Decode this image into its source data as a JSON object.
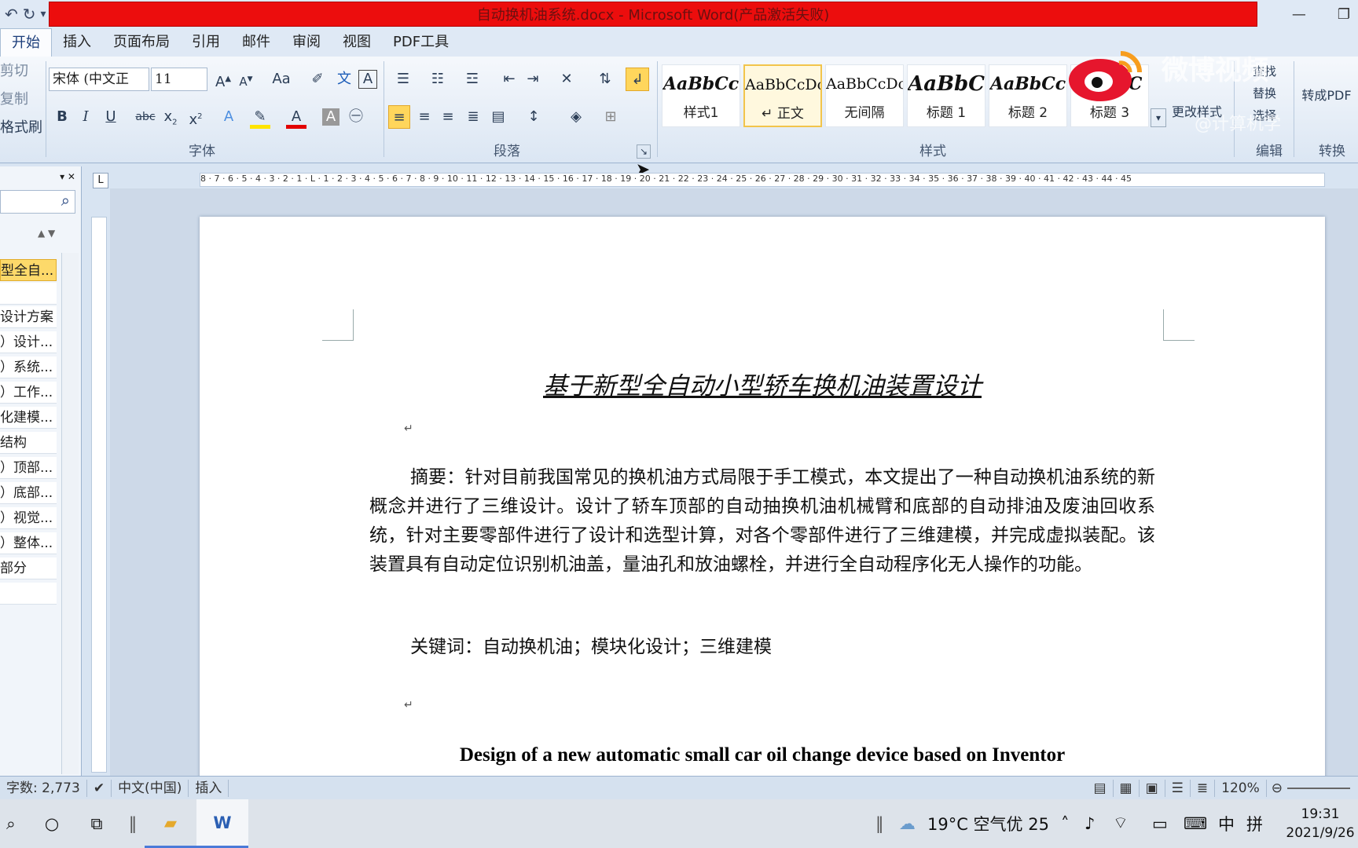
{
  "window": {
    "title": "自动换机油系统.docx - Microsoft Word(产品激活失败)"
  },
  "qat": {
    "undo": "↶",
    "redo": "↻",
    "more": "▾"
  },
  "tabs": [
    "开始",
    "插入",
    "页面布局",
    "引用",
    "邮件",
    "审阅",
    "视图",
    "PDF工具"
  ],
  "clipboard": {
    "cut": "剪切",
    "copy": "复制",
    "painter": "格式刷"
  },
  "font": {
    "name": "宋体 (中文正",
    "size": "11",
    "group": "字体"
  },
  "paragraph": {
    "group": "段落"
  },
  "styles": {
    "group": "样式",
    "items": [
      {
        "sample": "AaBbCc",
        "name": "样式1"
      },
      {
        "sample": "AaBbCcDc",
        "name": "↵ 正文"
      },
      {
        "sample": "AaBbCcDc",
        "name": "无间隔"
      },
      {
        "sample": "AaBbC",
        "name": "标题 1"
      },
      {
        "sample": "AaBbCc",
        "name": "标题 2"
      },
      {
        "sample": "AaBbC",
        "name": "标题 3"
      }
    ],
    "change": "更改样式"
  },
  "editing": {
    "group": "编辑",
    "find": "查找",
    "replace": "替换",
    "select": "选择"
  },
  "convert": {
    "group": "转换",
    "label": "转成PDF"
  },
  "watermark": {
    "text": "微博视频",
    "handle": "@计算机学"
  },
  "nav": {
    "items": [
      "型全自...",
      "",
      "设计方案",
      "）设计...",
      "）系统...",
      "）工作...",
      "化建模...",
      "结构",
      "）顶部...",
      "）底部...",
      "）视觉...",
      "）整体...",
      "部分",
      ""
    ]
  },
  "document": {
    "title": "基于新型全自动小型轿车换机油装置设计",
    "abstract": "摘要：针对目前我国常见的换机油方式局限于手工模式，本文提出了一种自动换机油系统的新概念并进行了三维设计。设计了轿车顶部的自动抽换机油机械臂和底部的自动排油及废油回收系统，针对主要零部件进行了设计和选型计算，对各个零部件进行了三维建模，并完成虚拟装配。该装置具有自动定位识别机油盖，量油孔和放油螺栓，并进行全自动程序化无人操作的功能。",
    "keywords": "关键词：自动换机油；模块化设计；三维建模",
    "en_title": "Design of a new automatic small car oil change device based on Inventor"
  },
  "ruler": {
    "marks": "8 · 7 · 6 · 5 · 4 · 3 · 2 · 1 · L · 1 · 2 · 3 · 4 · 5 · 6 · 7 · 8 · 9 · 10 · 11 · 12 · 13 · 14 · 15 · 16 · 17 · 18 · 19 · 20 · 21 · 22 · 23 · 24 · 25 · 26 · 27 · 28 · 29 · 30 · 31 · 32 · 33 · 34 · 35 · 36 · 37 · 38 · 39 · 40 · 41 · 42 · 43 · 44 · 45"
  },
  "status": {
    "words": "字数: 2,773",
    "lang": "中文(中国)",
    "mode": "插入",
    "zoom": "120%"
  },
  "taskbar": {
    "weather": "19°C 空气优 25",
    "ime": "中",
    "ime2": "拼",
    "time": "19:31",
    "date": "2021/9/26"
  }
}
